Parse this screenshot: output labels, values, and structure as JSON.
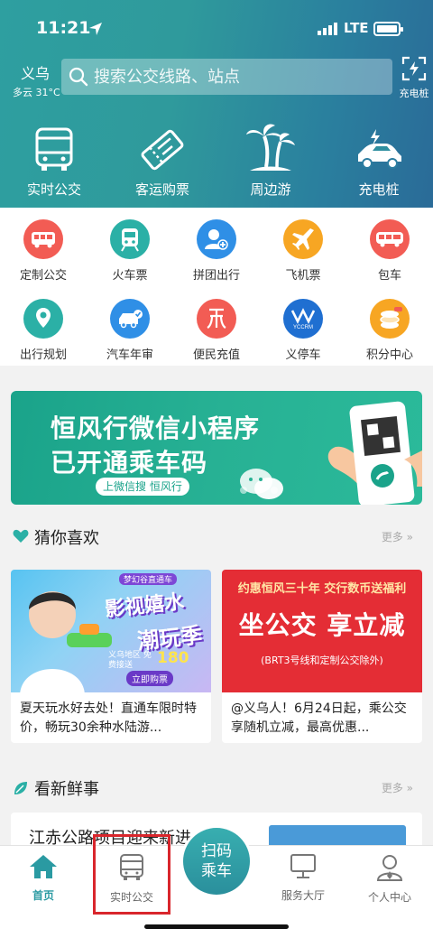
{
  "status_bar": {
    "time": "11:21",
    "network": "LTE"
  },
  "header": {
    "city": "义乌",
    "weather": "多云 31°C",
    "search_placeholder": "搜索公交线路、站点",
    "charge_label": "充电桩"
  },
  "main_nav": [
    {
      "label": "实时公交",
      "icon": "bus-icon"
    },
    {
      "label": "客运购票",
      "icon": "ticket-icon"
    },
    {
      "label": "周边游",
      "icon": "palm-tree-icon"
    },
    {
      "label": "充电桩",
      "icon": "electric-car-icon"
    }
  ],
  "services_row1": [
    {
      "label": "定制公交",
      "icon": "custom-bus-icon",
      "color": "#f25c54"
    },
    {
      "label": "火车票",
      "icon": "train-icon",
      "color": "#2bb0a6"
    },
    {
      "label": "拼团出行",
      "icon": "group-travel-icon",
      "color": "#2f8fe6"
    },
    {
      "label": "飞机票",
      "icon": "airplane-icon",
      "color": "#f7a623"
    },
    {
      "label": "包车",
      "icon": "charter-bus-icon",
      "color": "#f25c54"
    }
  ],
  "services_row2": [
    {
      "label": "出行规划",
      "icon": "route-plan-icon",
      "color": "#2bb0a6"
    },
    {
      "label": "汽车年审",
      "icon": "car-inspection-icon",
      "color": "#2f8fe6"
    },
    {
      "label": "便民充值",
      "icon": "recharge-icon",
      "color": "#f25c54"
    },
    {
      "label": "义停车",
      "icon": "parking-icon",
      "color": "#1f6fd1"
    },
    {
      "label": "积分中心",
      "icon": "points-coin-icon",
      "color": "#f7a623"
    }
  ],
  "banner": {
    "line1": "恒风行微信小程序",
    "line2": "已开通乘车码",
    "tag": "上微信搜 恒风行"
  },
  "guess_section": {
    "title": "猜你喜欢",
    "more": "更多 »"
  },
  "cards": [
    {
      "caption": "夏天玩水好去处！直通车限时特价，畅玩30余种水陆游...",
      "img_tag": "梦幻谷直通车",
      "img_title1": "影视嬉水",
      "img_title2": "潮玩季",
      "img_area": "义乌地区 免费接送",
      "img_price": "180",
      "img_buy": "立即购票"
    },
    {
      "caption": "@义乌人！6月24日起，乘公交享随机立减，最高优惠...",
      "img_sub": "约惠恒风三十年 交行数币送福利",
      "img_big": "坐公交 享立减",
      "img_note": "(BRT3号线和定制公交除外)"
    }
  ],
  "news_section": {
    "title": "看新鲜事",
    "more": "更多 »",
    "preview": "江赤公路项目迎来新进"
  },
  "tabbar": {
    "home": "首页",
    "realtime": "实时公交",
    "scan": "扫码乘车",
    "service": "服务大厅",
    "me": "个人中心"
  },
  "colors": {
    "brand": "#2a9aa2",
    "highlight": "#d9262c"
  }
}
